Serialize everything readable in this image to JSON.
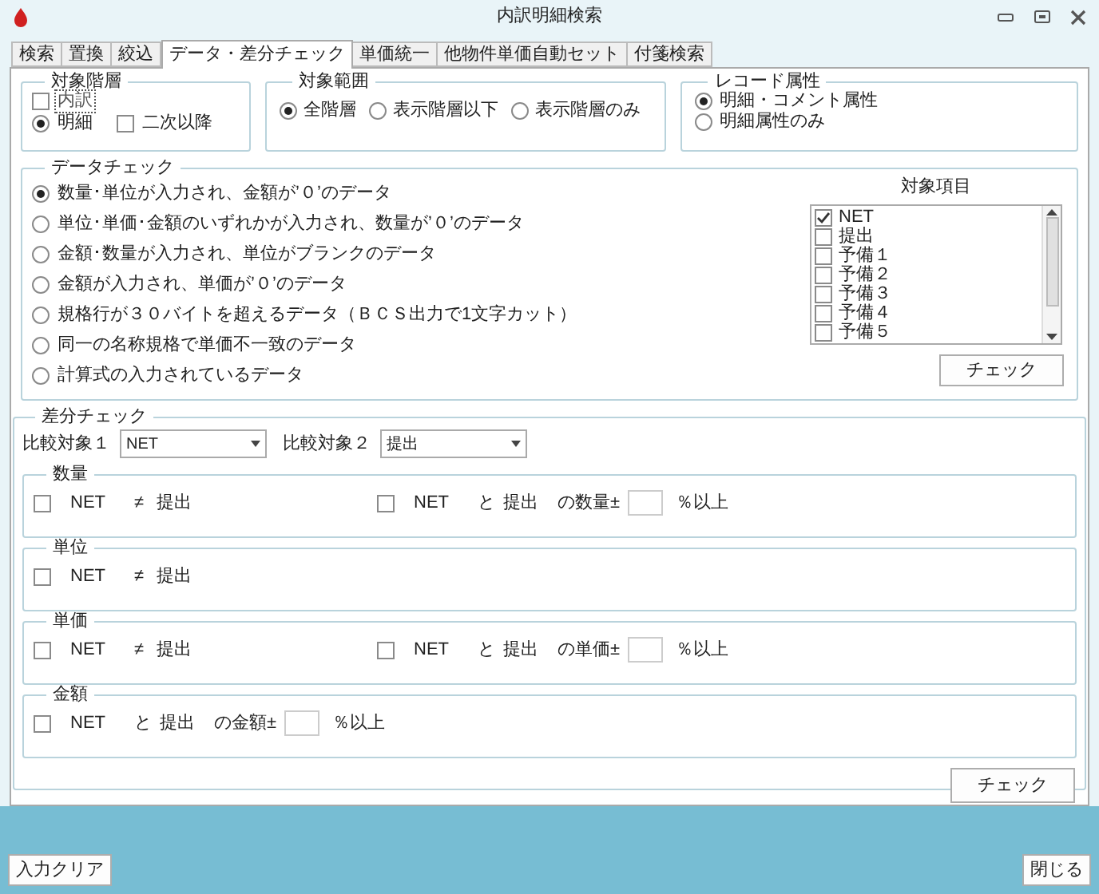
{
  "window": {
    "title": "内訳明細検索"
  },
  "tabs": [
    {
      "label": "検索",
      "selected": false
    },
    {
      "label": "置換",
      "selected": false
    },
    {
      "label": "絞込",
      "selected": false
    },
    {
      "label": "データ・差分チェック",
      "selected": true
    },
    {
      "label": "単価統一",
      "selected": false
    },
    {
      "label": "他物件単価自動セット",
      "selected": false
    },
    {
      "label": "付箋検索",
      "selected": false
    }
  ],
  "target_level": {
    "title": "対象階層",
    "items": [
      {
        "kind": "checkbox",
        "label": "内訳",
        "checked": false,
        "focused": true,
        "disabled": true
      },
      {
        "kind": "radio",
        "label": "明細",
        "selected": true,
        "focused": false,
        "disabled": false
      },
      {
        "kind": "checkbox",
        "label": "二次以降",
        "checked": false,
        "focused": false,
        "disabled": false
      }
    ]
  },
  "target_range": {
    "title": "対象範囲",
    "options": [
      {
        "label": "全階層",
        "selected": true
      },
      {
        "label": "表示階層以下",
        "selected": false
      },
      {
        "label": "表示階層のみ",
        "selected": false
      }
    ]
  },
  "record_attribute": {
    "title": "レコード属性",
    "options": [
      {
        "label": "明細・コメント属性",
        "selected": true
      },
      {
        "label": "明細属性のみ",
        "selected": false
      }
    ]
  },
  "data_check": {
    "title": "データチェック",
    "options": [
      {
        "label": "数量･単位が入力され、金額が’０’のデータ",
        "selected": true
      },
      {
        "label": "単位･単価･金額のいずれかが入力され、数量が’０’のデータ",
        "selected": false
      },
      {
        "label": "金額･数量が入力され、単位がブランクのデータ",
        "selected": false
      },
      {
        "label": "金額が入力され、単価が’０’のデータ",
        "selected": false
      },
      {
        "label": "規格行が３０バイトを超えるデータ（ＢＣＳ出力で1文字カット）",
        "selected": false
      },
      {
        "label": "同一の名称規格で単価不一致のデータ",
        "selected": false
      },
      {
        "label": "計算式の入力されているデータ",
        "selected": false
      }
    ],
    "target_items": {
      "title": "対象項目",
      "items": [
        {
          "label": "NET",
          "checked": true
        },
        {
          "label": "提出",
          "checked": false
        },
        {
          "label": "予備１",
          "checked": false
        },
        {
          "label": "予備２",
          "checked": false
        },
        {
          "label": "予備３",
          "checked": false
        },
        {
          "label": "予備４",
          "checked": false
        },
        {
          "label": "予備５",
          "checked": false
        }
      ]
    },
    "button": "チェック"
  },
  "diff_check": {
    "title": "差分チェック",
    "compare1": {
      "label": "比較対象１",
      "value": "NET"
    },
    "compare2": {
      "label": "比較対象２",
      "value": "提出"
    },
    "sections": [
      {
        "title": "数量",
        "rows": [
          {
            "kind": "not_equal",
            "a": "NET",
            "op": "≠",
            "b": "提出",
            "checked": false
          },
          {
            "kind": "tolerance",
            "a": "NET",
            "conj": "と",
            "b": "提出",
            "measure": "の数量±",
            "unit": "％以上",
            "checked": false
          }
        ]
      },
      {
        "title": "単位",
        "rows": [
          {
            "kind": "not_equal",
            "a": "NET",
            "op": "≠",
            "b": "提出",
            "checked": false
          }
        ]
      },
      {
        "title": "単価",
        "rows": [
          {
            "kind": "not_equal",
            "a": "NET",
            "op": "≠",
            "b": "提出",
            "checked": false
          },
          {
            "kind": "tolerance",
            "a": "NET",
            "conj": "と",
            "b": "提出",
            "measure": "の単価±",
            "unit": "％以上",
            "checked": false
          }
        ]
      },
      {
        "title": "金額",
        "rows": [
          {
            "kind": "tolerance",
            "a": "NET",
            "conj": "と",
            "b": "提出",
            "measure": "の金額±",
            "unit": "％以上",
            "checked": false
          }
        ]
      }
    ],
    "button": "チェック"
  },
  "footer": {
    "clear_button": "入力クリア",
    "close_button": "閉じる"
  }
}
